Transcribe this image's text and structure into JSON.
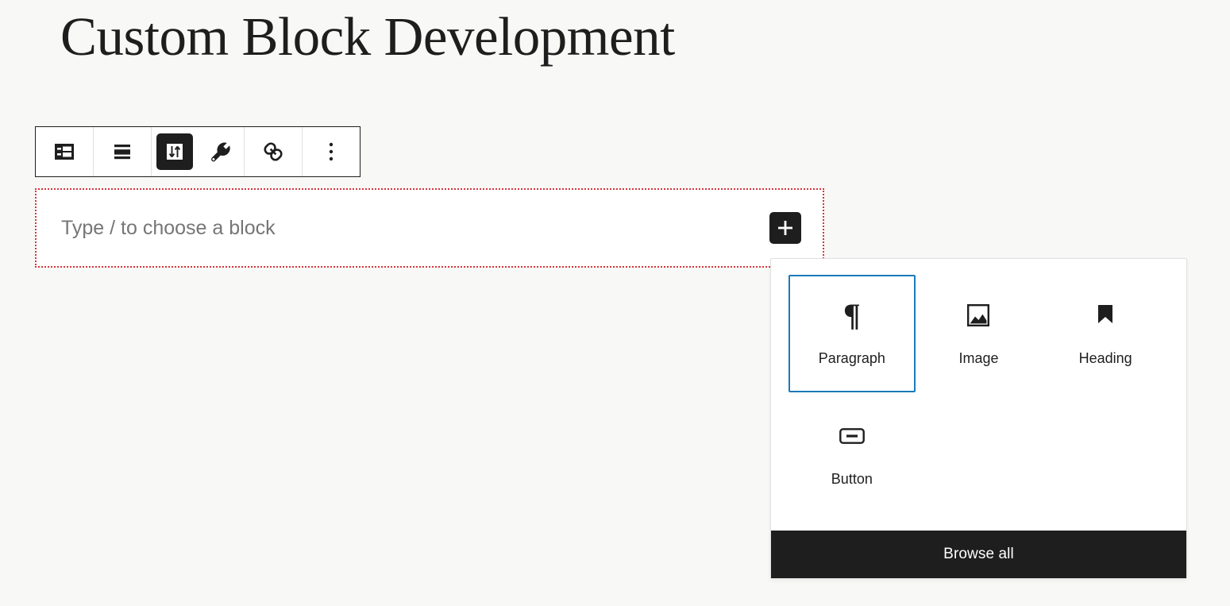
{
  "editor": {
    "background_color": "#f8f8f7",
    "post_title": "Custom Block Development"
  },
  "block_toolbar": {
    "accent_color": "#1e1e1e",
    "buttons": [
      {
        "name": "block-type-button",
        "icon": "block-type-icon",
        "label": "Paragraph block type",
        "active": false
      },
      {
        "name": "align-text-button",
        "icon": "align-center-icon",
        "label": "Align text",
        "active": false
      },
      {
        "name": "vertical-align-button",
        "icon": "vertical-align-icon",
        "label": "Change alignment",
        "active": true
      },
      {
        "name": "tools-button",
        "icon": "wrench-icon",
        "label": "Tools",
        "active": false
      },
      {
        "name": "link-button",
        "icon": "link-icon",
        "label": "Link",
        "active": false
      },
      {
        "name": "more-options-button",
        "icon": "ellipsis-vertical-icon",
        "label": "Options",
        "active": false
      }
    ]
  },
  "block_placeholder": {
    "placeholder_text": "Type / to choose a block",
    "border_color": "#d63638",
    "add_block_label": "Add block"
  },
  "inserter": {
    "selected_color": "#1b7bba",
    "items": [
      {
        "label": "Paragraph",
        "icon": "pilcrow-icon",
        "selected": true
      },
      {
        "label": "Image",
        "icon": "image-icon",
        "selected": false
      },
      {
        "label": "Heading",
        "icon": "bookmark-icon",
        "selected": false
      },
      {
        "label": "Button",
        "icon": "button-icon",
        "selected": false
      }
    ],
    "browse_all_label": "Browse all"
  }
}
